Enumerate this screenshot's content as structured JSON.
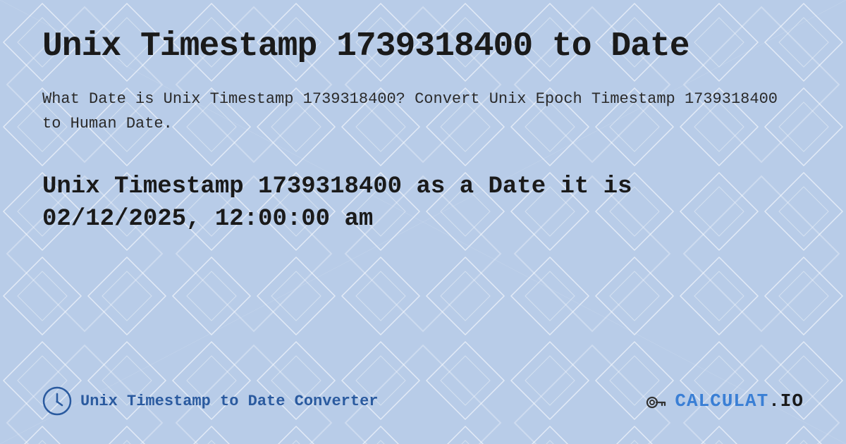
{
  "background": {
    "color": "#c8d8f0",
    "pattern": "diamond-lattice"
  },
  "title": {
    "text": "Unix Timestamp 1739318400 to Date"
  },
  "description": {
    "text": "What Date is Unix Timestamp 1739318400? Convert Unix Epoch Timestamp 1739318400 to Human Date."
  },
  "result": {
    "line1": "Unix Timestamp 1739318400 as a Date it is",
    "line2": "02/12/2025, 12:00:00 am"
  },
  "footer": {
    "converter_label": "Unix Timestamp to Date Converter",
    "logo_text": "CALCULAT.IO"
  }
}
